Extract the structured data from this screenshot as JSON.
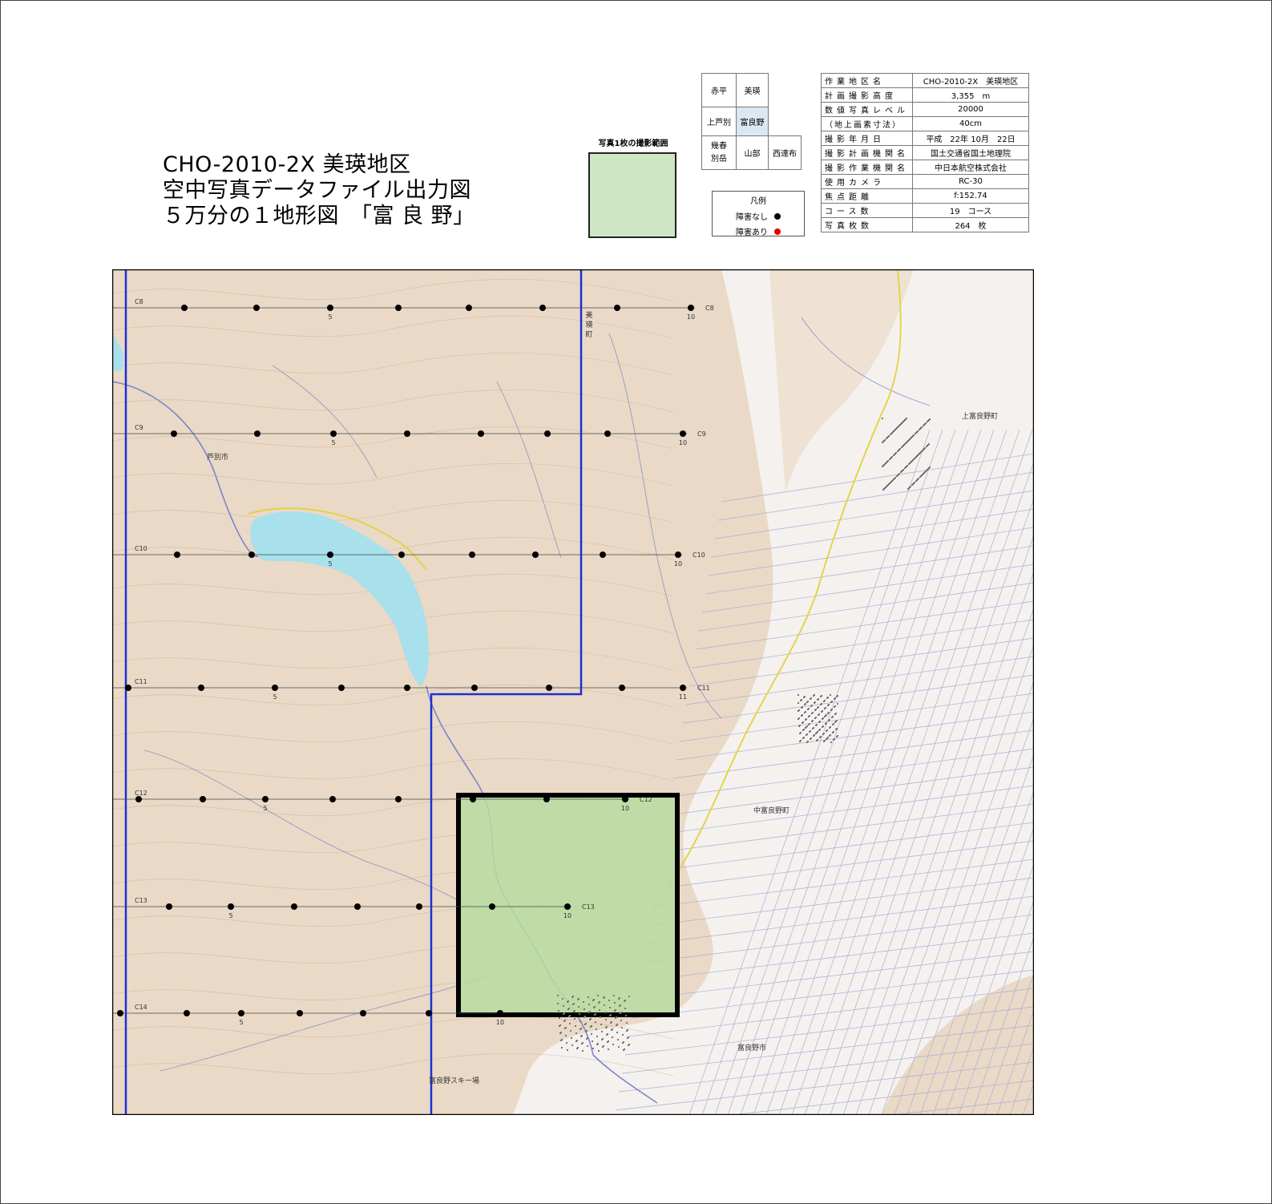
{
  "title": {
    "line1": "CHO-2010-2X 美瑛地区",
    "line2": "空中写真データファイル出力図",
    "line3": "５万分の１地形図　「富 良 野」"
  },
  "coverage": {
    "label": "写真1枚の撮影範囲"
  },
  "adjacent_sheets": {
    "r1c1": "赤平",
    "r1c2": "美瑛",
    "r2c1": "上芦別",
    "r2c2": "富良野",
    "r3c1": "幾春\n別岳",
    "r3c2": "山部",
    "r3c3": "西達布"
  },
  "legend": {
    "title": "凡例",
    "no_obstacle": "障害なし",
    "obstacle": "障害あり",
    "no_obstacle_color": "#000000",
    "obstacle_color": "#e00000"
  },
  "info": [
    {
      "key": "作業地区名",
      "value": "CHO-2010-2X　美瑛地区"
    },
    {
      "key": "計画撮影高度",
      "value": "3,355　m"
    },
    {
      "key": "数値写真レベル",
      "value": "20000"
    },
    {
      "key": "（地上画素寸法）",
      "value": "40cm"
    },
    {
      "key": "撮影年月日",
      "value": "平成　22年 10月　22日"
    },
    {
      "key": "撮影計画機関名",
      "value": "国土交通省国土地理院"
    },
    {
      "key": "撮影作業機関名",
      "value": "中日本航空株式会社"
    },
    {
      "key": "使用カメラ",
      "value": "RC-30"
    },
    {
      "key": "焦点距離",
      "value": "f:152.74"
    },
    {
      "key": "コース数",
      "value": "19　コース"
    },
    {
      "key": "写真枚数",
      "value": "264　枚"
    }
  ],
  "map": {
    "colors": {
      "terrain": "#e9d9c6",
      "plain": "#f4f1ef",
      "lake": "#a8e0ec",
      "river": "#7b86c9",
      "road": "#e3d23a",
      "grid": "#a8aed6",
      "boundary": "#1c2fd6",
      "highlight": "#b7dca1",
      "course_line": "#444444",
      "point": "#000000"
    },
    "place_labels": [
      "芦別市",
      "美瑛町",
      "上富良野町",
      "中富良野町",
      "富良野市",
      "富良野スキー場"
    ],
    "courses": [
      {
        "name": "C8",
        "label_right": "C8",
        "marks": {
          "5": "5",
          "10": "10"
        }
      },
      {
        "name": "C9",
        "label_right": "C9",
        "marks": {
          "5": "5",
          "10": "10"
        }
      },
      {
        "name": "C10",
        "label_right": "C10",
        "marks": {
          "5": "5",
          "10": "10"
        }
      },
      {
        "name": "C11",
        "label_right": "C11",
        "marks": {
          "5": "5",
          "11": "11"
        }
      },
      {
        "name": "C12",
        "label_right": "C12",
        "marks": {
          "5": "5",
          "10": "10"
        }
      },
      {
        "name": "C13",
        "label_right": "C13",
        "marks": {
          "5": "5",
          "10": "10"
        }
      },
      {
        "name": "C14",
        "label_right": "",
        "marks": {
          "5": "5",
          "10": "10"
        }
      }
    ]
  }
}
